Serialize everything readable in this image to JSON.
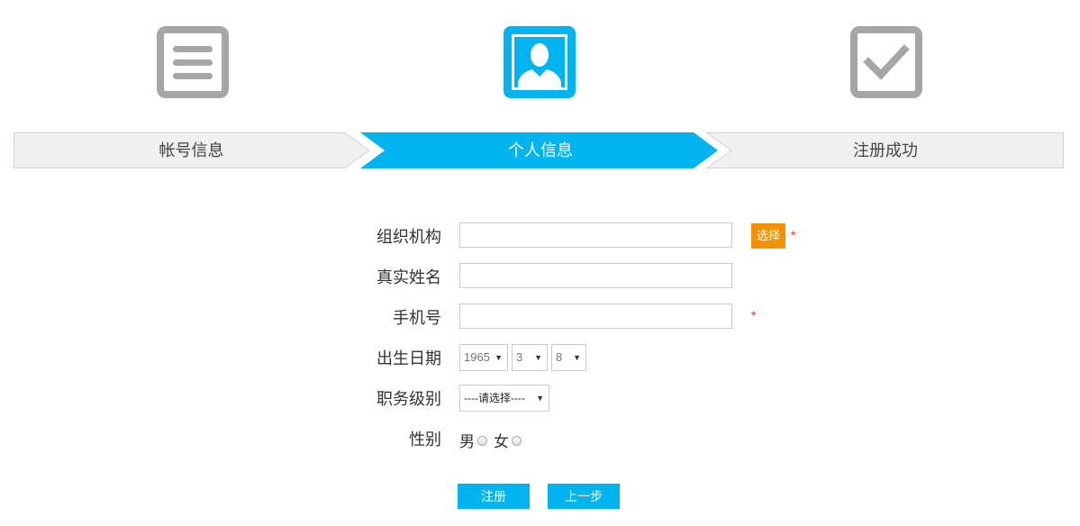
{
  "steps": [
    {
      "label": "帐号信息",
      "icon": "list-icon",
      "state": "inactive"
    },
    {
      "label": "个人信息",
      "icon": "user-icon",
      "state": "active"
    },
    {
      "label": "注册成功",
      "icon": "checkbox-check-icon",
      "state": "inactive"
    }
  ],
  "colors": {
    "accent": "#00b4ef",
    "inactive_icon": "#a6a6a6",
    "inactive_step": "#f0f0f0",
    "choose_button": "#f39100",
    "required_star": "#e8380d"
  },
  "form": {
    "org": {
      "label": "组织机构",
      "value": "",
      "choose_label": "选择",
      "required": "*"
    },
    "real_name": {
      "label": "真实姓名",
      "value": ""
    },
    "phone": {
      "label": "手机号",
      "value": "",
      "required": "*"
    },
    "birth": {
      "label": "出生日期",
      "year": "1965",
      "month": "3",
      "day": "8"
    },
    "job_level": {
      "label": "职务级别",
      "value": "----请选择----"
    },
    "gender": {
      "label": "性别",
      "options": [
        "男",
        "女"
      ],
      "selected": null
    }
  },
  "actions": {
    "register": "注册",
    "prev": "上一步"
  }
}
